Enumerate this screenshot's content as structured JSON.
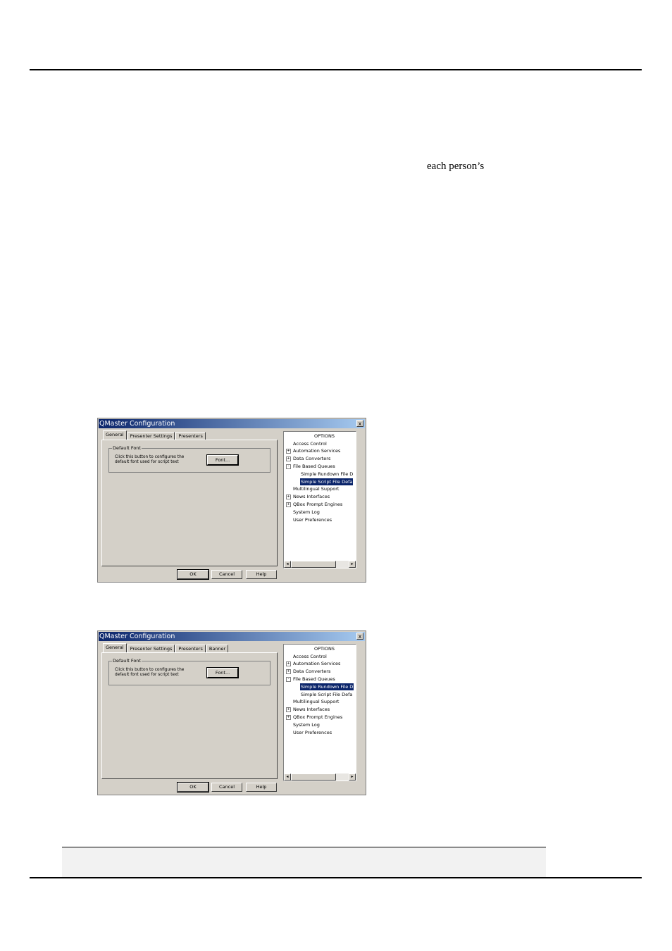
{
  "body_text": {
    "fragment": "each person’s"
  },
  "dialog1": {
    "title": "QMaster Configuration",
    "close": "x",
    "tabs": [
      "General",
      "Presenter Settings",
      "Presenters"
    ],
    "group_title": "Default Font",
    "group_desc": "Click this button to configures the default font used for script text",
    "font_button": "Font...",
    "buttons": {
      "ok": "OK",
      "cancel": "Cancel",
      "help": "Help"
    },
    "tree": [
      "OPTIONS",
      "Access Control",
      "Automation Services",
      "Data Converters",
      "File Based Queues",
      "Simple Rundown File D",
      "Simple Script File Defa",
      "Multilingual Support",
      "News Interfaces",
      "QBox Prompt Engines",
      "System Log",
      "User Preferences"
    ],
    "selected_item": "Simple Script File Defa"
  },
  "dialog2": {
    "title": "QMaster Configuration",
    "close": "x",
    "tabs": [
      "General",
      "Presenter Settings",
      "Presenters",
      "Banner"
    ],
    "group_title": "Default Font",
    "group_desc": "Click this button to configures the default font used for script text",
    "font_button": "Font...",
    "buttons": {
      "ok": "OK",
      "cancel": "Cancel",
      "help": "Help"
    },
    "tree": [
      "OPTIONS",
      "Access Control",
      "Automation Services",
      "Data Converters",
      "File Based Queues",
      "Simple Rundown File D",
      "Simple Script File Defa",
      "Multilingual Support",
      "News Interfaces",
      "QBox Prompt Engines",
      "System Log",
      "User Preferences"
    ],
    "selected_item": "Simple Rundown File D"
  },
  "icons": {
    "scroll_left": "left-arrow-icon",
    "scroll_right": "right-arrow-icon",
    "expand": "plus-icon",
    "collapse": "minus-icon"
  }
}
